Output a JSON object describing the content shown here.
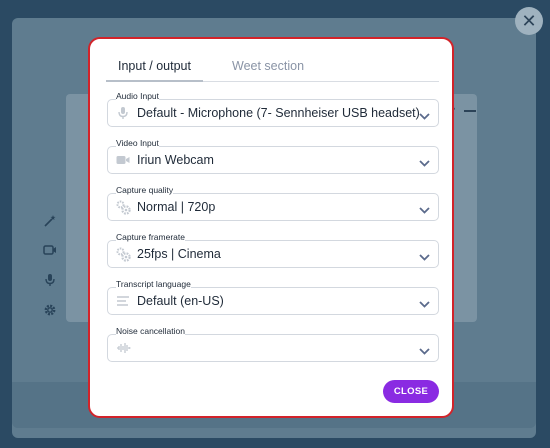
{
  "modal": {
    "tabs": [
      {
        "label": "Input / output"
      },
      {
        "label": "Weet section"
      }
    ],
    "fields": [
      {
        "label": "Audio Input",
        "value": "Default - Microphone (7- Sennheiser USB headset)",
        "icon": "microphone-icon"
      },
      {
        "label": "Video Input",
        "value": "Iriun Webcam",
        "icon": "camera-icon"
      },
      {
        "label": "Capture quality",
        "value": "Normal | 720p",
        "icon": "gears-icon"
      },
      {
        "label": "Capture framerate",
        "value": "25fps | Cinema",
        "icon": "gears-icon"
      },
      {
        "label": "Transcript language",
        "value": "Default (en-US)",
        "icon": "lines-icon"
      },
      {
        "label": "Noise cancellation",
        "value": "",
        "icon": "waveform-icon"
      }
    ],
    "close_label": "CLOSE"
  },
  "colors": {
    "accent": "#8a2be2",
    "highlight_border": "#d2232a",
    "icon_grey": "#c3c9d1"
  }
}
